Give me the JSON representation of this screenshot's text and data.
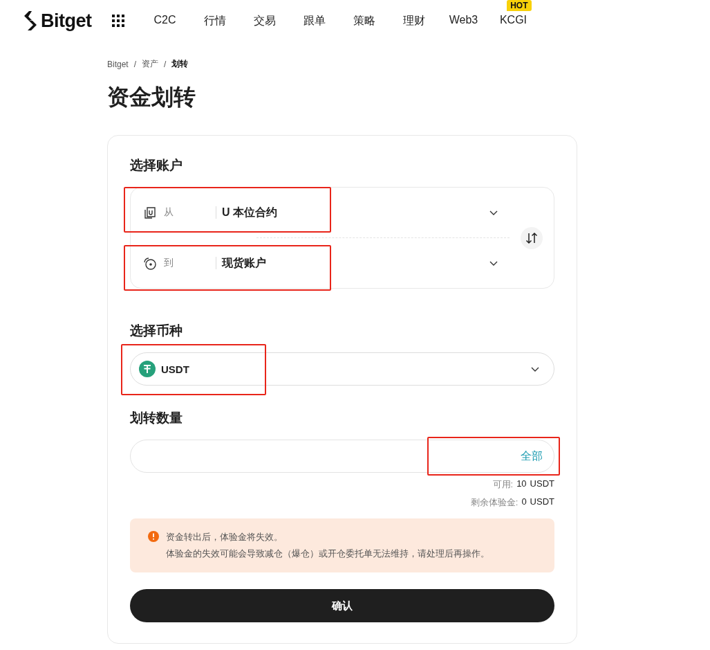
{
  "header": {
    "logo": "Bitget",
    "nav": [
      {
        "label": "C2C"
      },
      {
        "label": "行情"
      },
      {
        "label": "交易"
      },
      {
        "label": "跟单"
      },
      {
        "label": "策略"
      },
      {
        "label": "理财"
      },
      {
        "label": "Web3"
      },
      {
        "label": "KCGI",
        "badge": "HOT"
      }
    ]
  },
  "breadcrumb": {
    "items": [
      {
        "label": "Bitget",
        "current": false
      },
      {
        "label": "资产",
        "current": false
      },
      {
        "label": "划转",
        "current": true
      }
    ],
    "separators": [
      "/",
      "/"
    ]
  },
  "title": "资金划转",
  "accounts": {
    "heading": "选择账户",
    "from": {
      "label": "从",
      "value": "U 本位合约",
      "highlighted": true
    },
    "to": {
      "label": "到",
      "value": "现货账户",
      "highlighted": true
    }
  },
  "coin": {
    "heading": "选择币种",
    "value": "USDT",
    "highlighted": true
  },
  "amount": {
    "heading": "划转数量",
    "all_button": "全部",
    "all_highlighted": true,
    "available_label": "可用:",
    "available_value": "10",
    "available_unit": "USDT",
    "trial_label": "剩余体验金:",
    "trial_value": "0",
    "trial_unit": "USDT"
  },
  "notice": {
    "lines": [
      "资金转出后，体验金将失效。",
      "体验金的失效可能会导致减仓（爆仓）或开仓委托单无法维持，请处理后再操作。"
    ]
  },
  "confirm_button": "确认"
}
